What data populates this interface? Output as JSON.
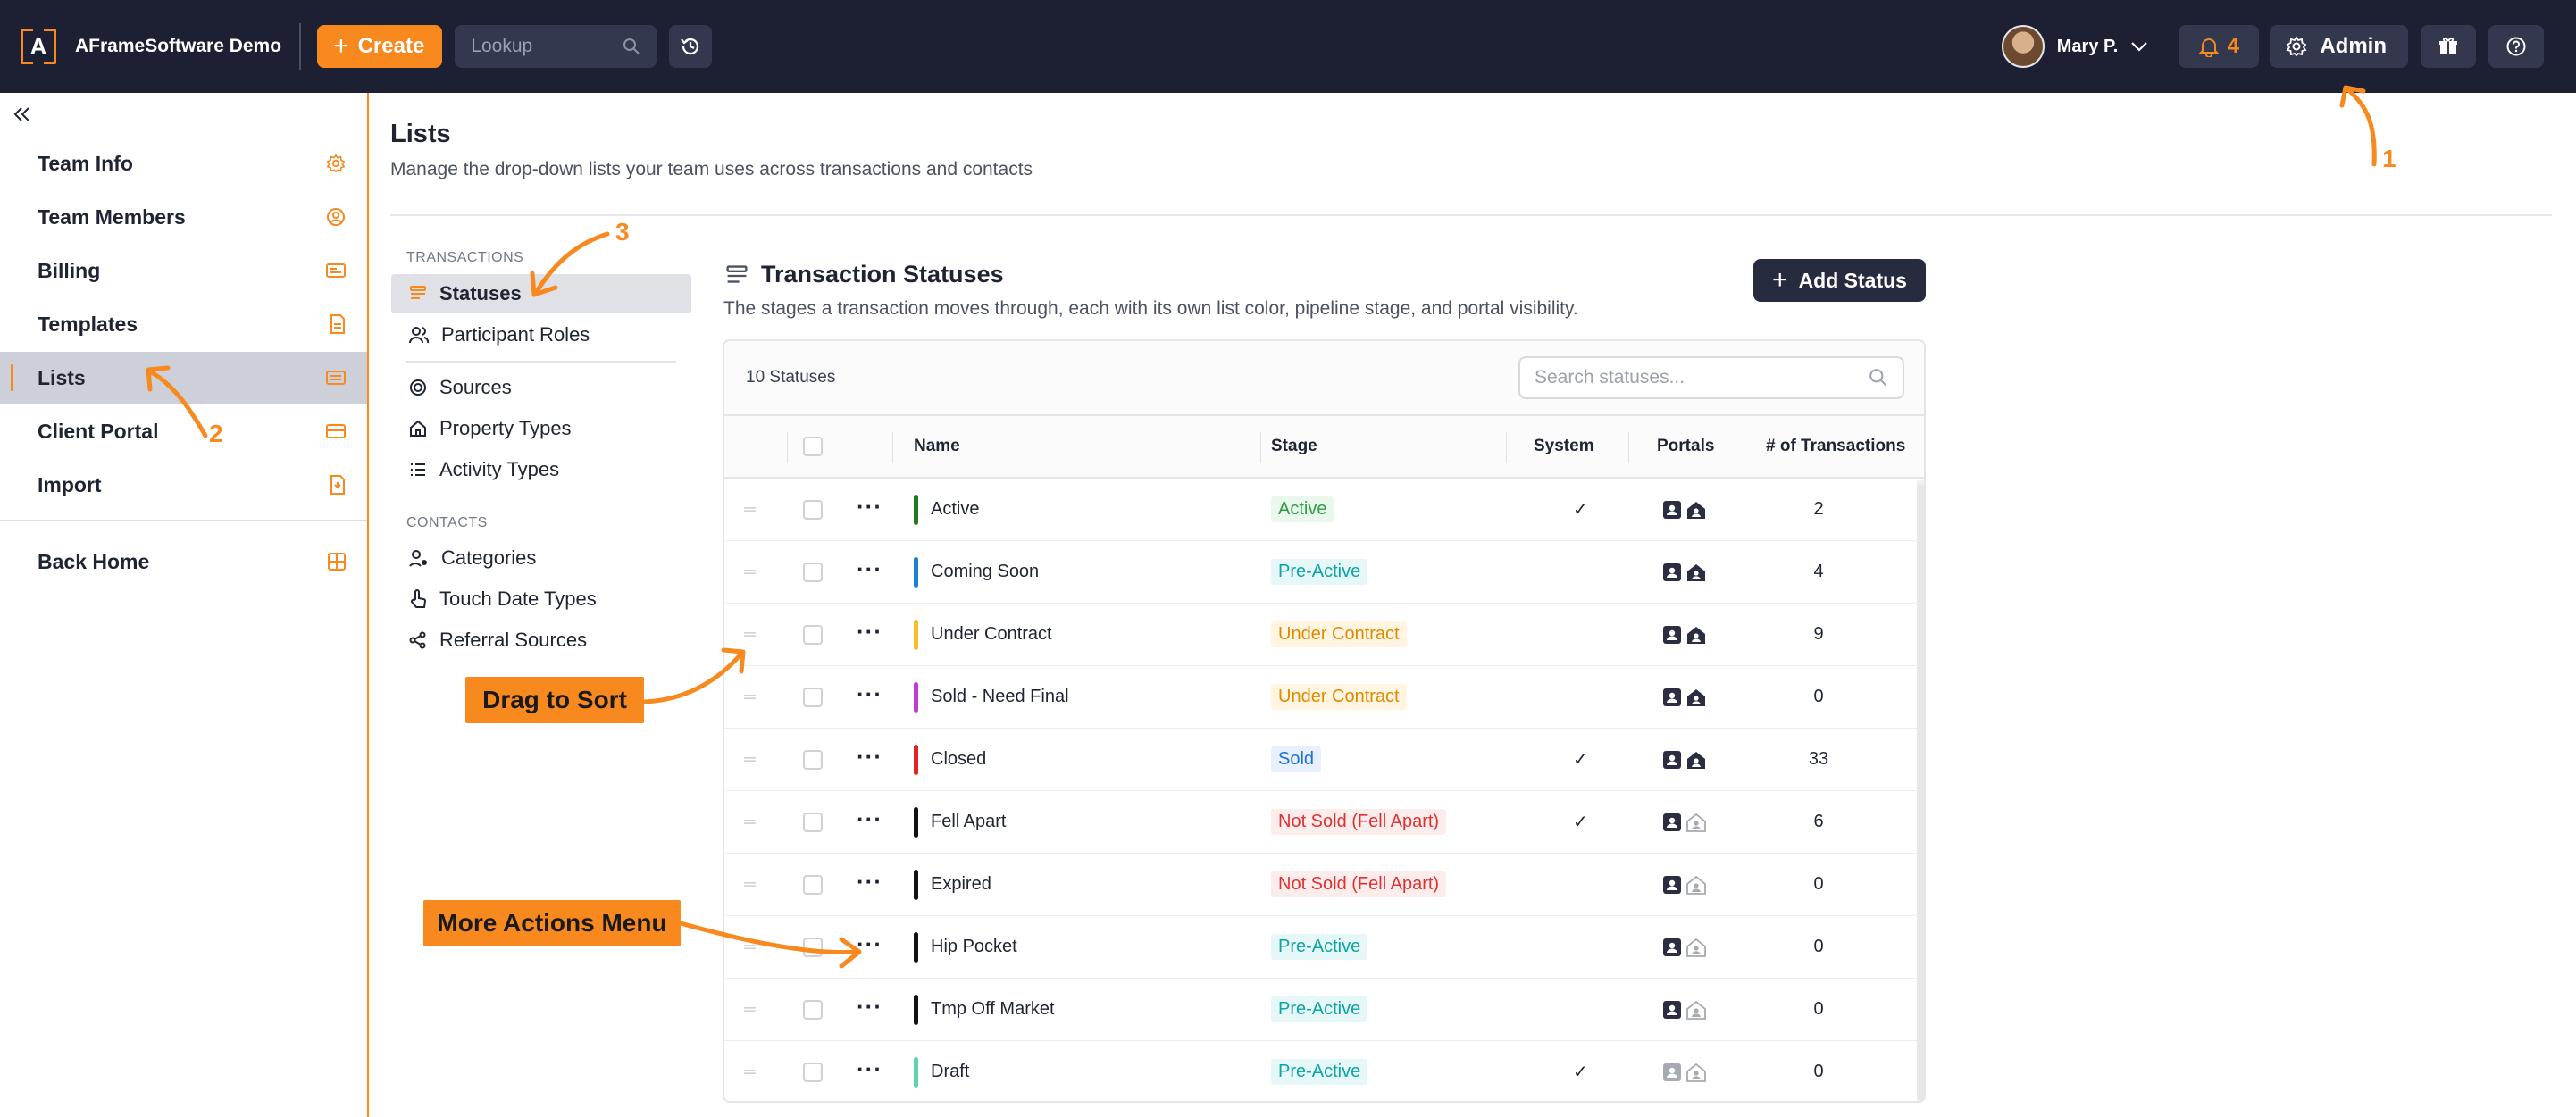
{
  "topbar": {
    "brand": "AFrameSoftware Demo",
    "logo_letter": "A",
    "create_label": "Create",
    "lookup_placeholder": "Lookup",
    "user_name": "Mary P.",
    "notification_count": "4",
    "admin_label": "Admin"
  },
  "sidebar": {
    "items": [
      {
        "label": "Team Info",
        "icon": "gear-icon"
      },
      {
        "label": "Team Members",
        "icon": "user-circle-icon"
      },
      {
        "label": "Billing",
        "icon": "billing-icon"
      },
      {
        "label": "Templates",
        "icon": "document-icon"
      },
      {
        "label": "Lists",
        "icon": "list-icon"
      },
      {
        "label": "Client Portal",
        "icon": "card-icon"
      },
      {
        "label": "Import",
        "icon": "import-icon"
      }
    ],
    "back_home": "Back Home"
  },
  "page": {
    "title": "Lists",
    "subtitle": "Manage the drop-down lists your team uses across transactions and contacts"
  },
  "submenu": {
    "transactions_heading": "TRANSACTIONS",
    "transactions": [
      "Statuses",
      "Participant Roles"
    ],
    "transactions_more": [
      "Sources",
      "Property Types",
      "Activity Types"
    ],
    "contacts_heading": "CONTACTS",
    "contacts": [
      "Categories",
      "Touch Date Types",
      "Referral Sources"
    ]
  },
  "section": {
    "title": "Transaction Statuses",
    "description": "The stages a transaction moves through, each with its own list color, pipeline stage, and portal visibility.",
    "add_label": "Add Status"
  },
  "table": {
    "count_label": "10 Statuses",
    "search_placeholder": "Search statuses...",
    "headers": {
      "name": "Name",
      "stage": "Stage",
      "system": "System",
      "portals": "Portals",
      "transactions": "# of Transactions"
    },
    "check_mark": "✓",
    "rows": [
      {
        "name": "Active",
        "color": "#1f7a1f",
        "stage": "Active",
        "stage_key": "active",
        "system": true,
        "portal_agent": true,
        "portal_home": true,
        "transactions": "2"
      },
      {
        "name": "Coming Soon",
        "color": "#1c7ed6",
        "stage": "Pre-Active",
        "stage_key": "pre",
        "system": false,
        "portal_agent": true,
        "portal_home": true,
        "transactions": "4"
      },
      {
        "name": "Under Contract",
        "color": "#f5c026",
        "stage": "Under Contract",
        "stage_key": "uc",
        "system": false,
        "portal_agent": true,
        "portal_home": true,
        "transactions": "9"
      },
      {
        "name": "Sold - Need Final",
        "color": "#c13bd6",
        "stage": "Under Contract",
        "stage_key": "uc",
        "system": false,
        "portal_agent": true,
        "portal_home": true,
        "transactions": "0"
      },
      {
        "name": "Closed",
        "color": "#e02424",
        "stage": "Sold",
        "stage_key": "sold",
        "system": true,
        "portal_agent": true,
        "portal_home": true,
        "transactions": "33"
      },
      {
        "name": "Fell Apart",
        "color": "#111111",
        "stage": "Not Sold (Fell Apart)",
        "stage_key": "ns",
        "system": true,
        "portal_agent": true,
        "portal_home": false,
        "transactions": "6"
      },
      {
        "name": "Expired",
        "color": "#111111",
        "stage": "Not Sold (Fell Apart)",
        "stage_key": "ns",
        "system": false,
        "portal_agent": true,
        "portal_home": false,
        "transactions": "0"
      },
      {
        "name": "Hip Pocket",
        "color": "#111111",
        "stage": "Pre-Active",
        "stage_key": "pre",
        "system": false,
        "portal_agent": true,
        "portal_home": false,
        "transactions": "0"
      },
      {
        "name": "Tmp Off Market",
        "color": "#111111",
        "stage": "Pre-Active",
        "stage_key": "pre",
        "system": false,
        "portal_agent": true,
        "portal_home": false,
        "transactions": "0"
      },
      {
        "name": "Draft",
        "color": "#5fd3b0",
        "stage": "Pre-Active",
        "stage_key": "pre",
        "system": true,
        "portal_agent": false,
        "portal_home": false,
        "transactions": "0"
      }
    ]
  },
  "annotations": {
    "drag_label": "Drag to Sort",
    "more_label": "More Actions Menu",
    "n1": "1",
    "n2": "2",
    "n3": "3"
  },
  "colors": {
    "accent": "#f7891f",
    "topbar": "#1d2033",
    "stage_active": "#2f9e44",
    "stage_pre": "#0ca5a5",
    "stage_uc": "#e08a00",
    "stage_sold": "#1c6fd6",
    "stage_ns": "#e03131"
  }
}
